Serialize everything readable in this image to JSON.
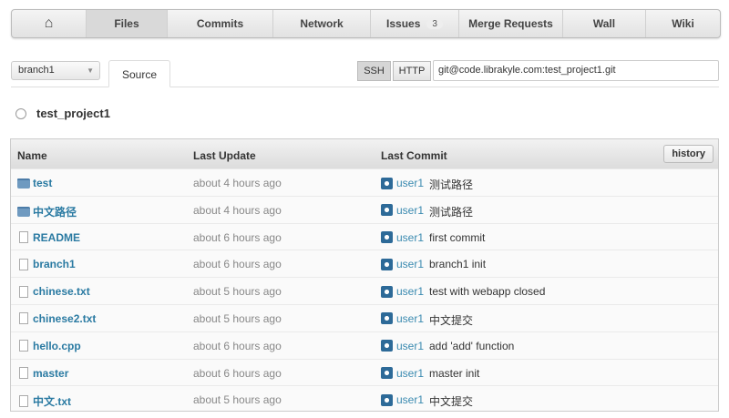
{
  "nav": {
    "items": [
      {
        "label": "",
        "icon": "home-icon"
      },
      {
        "label": "Files",
        "active": true
      },
      {
        "label": "Commits"
      },
      {
        "label": "Network"
      },
      {
        "label": "Issues",
        "badge": "3"
      },
      {
        "label": "Merge Requests"
      },
      {
        "label": "Wall"
      },
      {
        "label": "Wiki"
      }
    ]
  },
  "branch": {
    "selected": "branch1"
  },
  "source_tab": "Source",
  "clone": {
    "ssh": "SSH",
    "http": "HTTP",
    "url": "git@code.librakyle.com:test_project1.git"
  },
  "project_title": "test_project1",
  "table": {
    "headers": {
      "name": "Name",
      "update": "Last Update",
      "commit": "Last Commit"
    },
    "history": "history",
    "rows": [
      {
        "name": "test",
        "type": "folder",
        "update": "about 4 hours ago",
        "user": "user1",
        "message": "测试路径"
      },
      {
        "name": "中文路径",
        "type": "folder",
        "update": "about 4 hours ago",
        "user": "user1",
        "message": "测试路径"
      },
      {
        "name": "README",
        "type": "file",
        "update": "about 6 hours ago",
        "user": "user1",
        "message": "first commit"
      },
      {
        "name": "branch1",
        "type": "file",
        "update": "about 6 hours ago",
        "user": "user1",
        "message": "branch1 init"
      },
      {
        "name": "chinese.txt",
        "type": "file",
        "update": "about 5 hours ago",
        "user": "user1",
        "message": "test with webapp closed"
      },
      {
        "name": "chinese2.txt",
        "type": "file",
        "update": "about 5 hours ago",
        "user": "user1",
        "message": "中文提交"
      },
      {
        "name": "hello.cpp",
        "type": "file",
        "update": "about 6 hours ago",
        "user": "user1",
        "message": "add 'add' function"
      },
      {
        "name": "master",
        "type": "file",
        "update": "about 6 hours ago",
        "user": "user1",
        "message": "master init"
      },
      {
        "name": "中文.txt",
        "type": "file",
        "update": "about 5 hours ago",
        "user": "user1",
        "message": "中文提交"
      }
    ]
  }
}
